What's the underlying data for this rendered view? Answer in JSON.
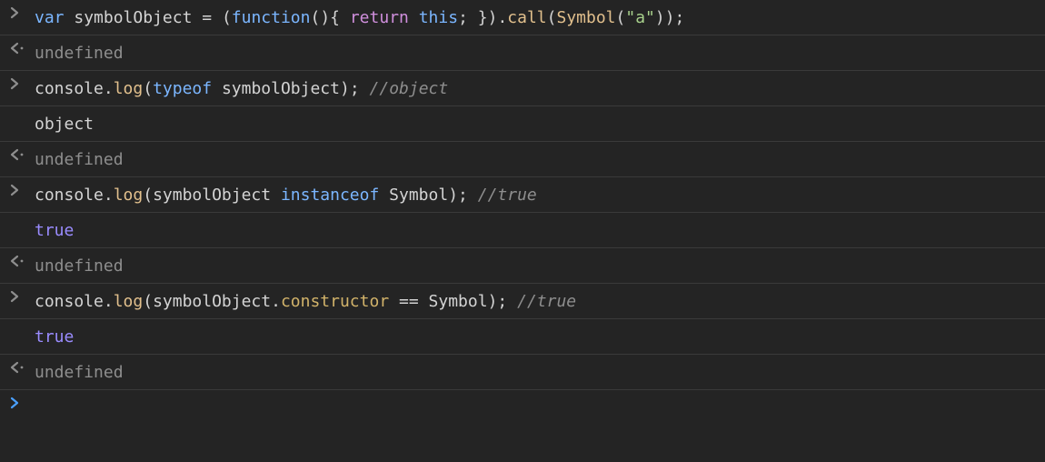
{
  "rows": [
    {
      "type": "input",
      "tokens": [
        {
          "cls": "tok-keyword2",
          "t": "var"
        },
        {
          "cls": "tok-plain",
          "t": " "
        },
        {
          "cls": "tok-var",
          "t": "symbolObject"
        },
        {
          "cls": "tok-plain",
          "t": " "
        },
        {
          "cls": "tok-op",
          "t": "="
        },
        {
          "cls": "tok-plain",
          "t": " "
        },
        {
          "cls": "tok-paren",
          "t": "("
        },
        {
          "cls": "tok-keyword2",
          "t": "function"
        },
        {
          "cls": "tok-paren",
          "t": "(){"
        },
        {
          "cls": "tok-plain",
          "t": " "
        },
        {
          "cls": "tok-keyword",
          "t": "return"
        },
        {
          "cls": "tok-plain",
          "t": " "
        },
        {
          "cls": "tok-keyword2",
          "t": "this"
        },
        {
          "cls": "tok-plain",
          "t": "; "
        },
        {
          "cls": "tok-paren",
          "t": "})."
        },
        {
          "cls": "tok-func",
          "t": "call"
        },
        {
          "cls": "tok-paren",
          "t": "("
        },
        {
          "cls": "tok-func",
          "t": "Symbol"
        },
        {
          "cls": "tok-paren",
          "t": "("
        },
        {
          "cls": "tok-string",
          "t": "\"a\""
        },
        {
          "cls": "tok-paren",
          "t": "));"
        }
      ]
    },
    {
      "type": "return",
      "tokens": [
        {
          "cls": "tok-undef",
          "t": "undefined"
        }
      ]
    },
    {
      "type": "input",
      "tokens": [
        {
          "cls": "tok-obj",
          "t": "console"
        },
        {
          "cls": "tok-paren",
          "t": "."
        },
        {
          "cls": "tok-func",
          "t": "log"
        },
        {
          "cls": "tok-paren",
          "t": "("
        },
        {
          "cls": "tok-keyword2",
          "t": "typeof"
        },
        {
          "cls": "tok-plain",
          "t": " "
        },
        {
          "cls": "tok-var",
          "t": "symbolObject"
        },
        {
          "cls": "tok-paren",
          "t": ");"
        },
        {
          "cls": "tok-plain",
          "t": " "
        },
        {
          "cls": "tok-comment",
          "t": "//object"
        }
      ]
    },
    {
      "type": "log",
      "tokens": [
        {
          "cls": "tok-plain",
          "t": "object"
        }
      ]
    },
    {
      "type": "return",
      "tokens": [
        {
          "cls": "tok-undef",
          "t": "undefined"
        }
      ]
    },
    {
      "type": "input",
      "tokens": [
        {
          "cls": "tok-obj",
          "t": "console"
        },
        {
          "cls": "tok-paren",
          "t": "."
        },
        {
          "cls": "tok-func",
          "t": "log"
        },
        {
          "cls": "tok-paren",
          "t": "("
        },
        {
          "cls": "tok-var",
          "t": "symbolObject"
        },
        {
          "cls": "tok-plain",
          "t": " "
        },
        {
          "cls": "tok-keyword2",
          "t": "instanceof"
        },
        {
          "cls": "tok-plain",
          "t": " "
        },
        {
          "cls": "tok-var",
          "t": "Symbol"
        },
        {
          "cls": "tok-paren",
          "t": ");"
        },
        {
          "cls": "tok-plain",
          "t": " "
        },
        {
          "cls": "tok-comment",
          "t": "//true"
        }
      ]
    },
    {
      "type": "log",
      "tokens": [
        {
          "cls": "tok-bool",
          "t": "true"
        }
      ]
    },
    {
      "type": "return",
      "tokens": [
        {
          "cls": "tok-undef",
          "t": "undefined"
        }
      ]
    },
    {
      "type": "input",
      "tokens": [
        {
          "cls": "tok-obj",
          "t": "console"
        },
        {
          "cls": "tok-paren",
          "t": "."
        },
        {
          "cls": "tok-func",
          "t": "log"
        },
        {
          "cls": "tok-paren",
          "t": "("
        },
        {
          "cls": "tok-var",
          "t": "symbolObject"
        },
        {
          "cls": "tok-paren",
          "t": "."
        },
        {
          "cls": "tok-func2",
          "t": "constructor"
        },
        {
          "cls": "tok-plain",
          "t": " "
        },
        {
          "cls": "tok-op",
          "t": "=="
        },
        {
          "cls": "tok-plain",
          "t": " "
        },
        {
          "cls": "tok-var",
          "t": "Symbol"
        },
        {
          "cls": "tok-paren",
          "t": ");"
        },
        {
          "cls": "tok-plain",
          "t": " "
        },
        {
          "cls": "tok-comment",
          "t": "//true"
        }
      ]
    },
    {
      "type": "log",
      "tokens": [
        {
          "cls": "tok-bool",
          "t": "true"
        }
      ]
    },
    {
      "type": "return",
      "tokens": [
        {
          "cls": "tok-undef",
          "t": "undefined"
        }
      ]
    },
    {
      "type": "prompt",
      "tokens": []
    }
  ]
}
